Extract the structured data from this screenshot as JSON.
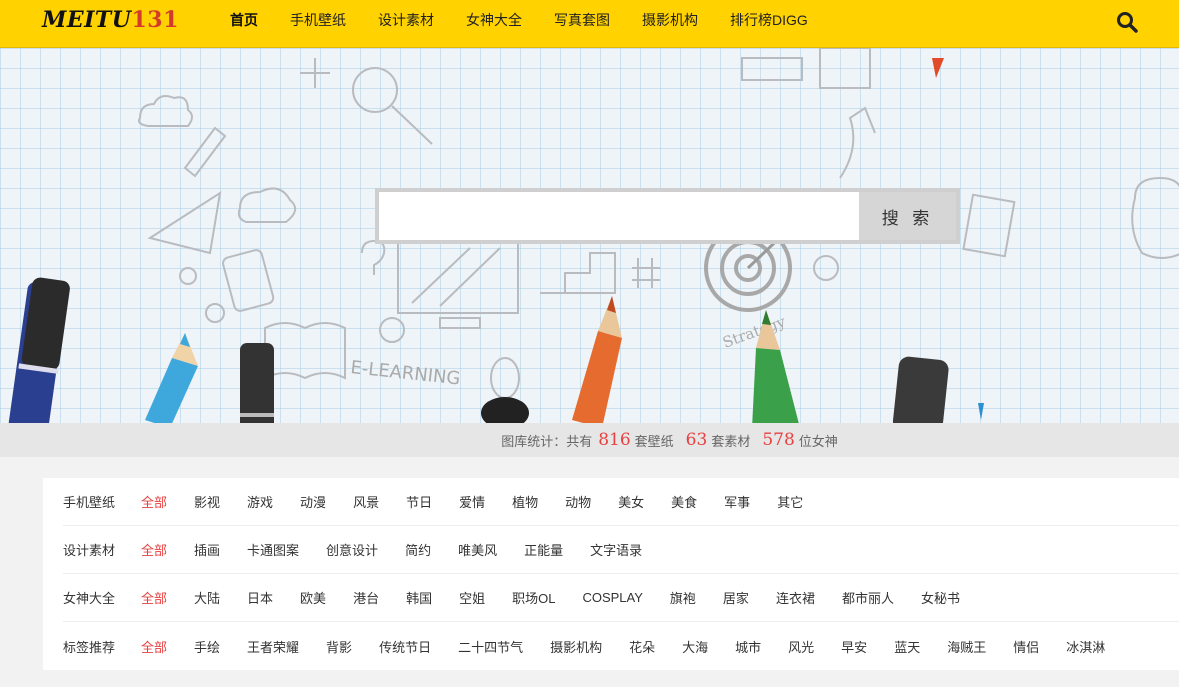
{
  "header": {
    "logo_part1": "MEITU",
    "logo_part2": "131",
    "nav": [
      "首页",
      "手机壁纸",
      "设计素材",
      "女神大全",
      "写真套图",
      "摄影机构",
      "排行榜DIGG"
    ],
    "search_icon": "search-icon",
    "colors": {
      "bar": "#ffd200",
      "logo_accent": "#d43a2a"
    }
  },
  "banner": {
    "doodle_text": "E-LEARNING",
    "doodle_text2": "Strategy",
    "search_placeholder": "",
    "search_button": "搜 索"
  },
  "stats": {
    "prefix": "图库统计：共有",
    "wallpapers": "816",
    "wallpapers_label": "套壁纸",
    "materials": "63",
    "materials_label": "套素材",
    "goddesses": "578",
    "goddesses_label": "位女神",
    "number_color": "#e84040"
  },
  "categories": [
    {
      "title": "手机壁纸",
      "links": [
        "全部",
        "影视",
        "游戏",
        "动漫",
        "风景",
        "节日",
        "爱情",
        "植物",
        "动物",
        "美女",
        "美食",
        "军事",
        "其它"
      ]
    },
    {
      "title": "设计素材",
      "links": [
        "全部",
        "插画",
        "卡通图案",
        "创意设计",
        "简约",
        "唯美风",
        "正能量",
        "文字语录"
      ]
    },
    {
      "title": "女神大全",
      "links": [
        "全部",
        "大陆",
        "日本",
        "欧美",
        "港台",
        "韩国",
        "空姐",
        "职场OL",
        "COSPLAY",
        "旗袍",
        "居家",
        "连衣裙",
        "都市丽人",
        "女秘书"
      ]
    },
    {
      "title": "标签推荐",
      "links": [
        "全部",
        "手绘",
        "王者荣耀",
        "背影",
        "传统节日",
        "二十四节气",
        "摄影机构",
        "花朵",
        "大海",
        "城市",
        "风光",
        "早安",
        "蓝天",
        "海贼王",
        "情侣",
        "冰淇淋"
      ]
    }
  ]
}
